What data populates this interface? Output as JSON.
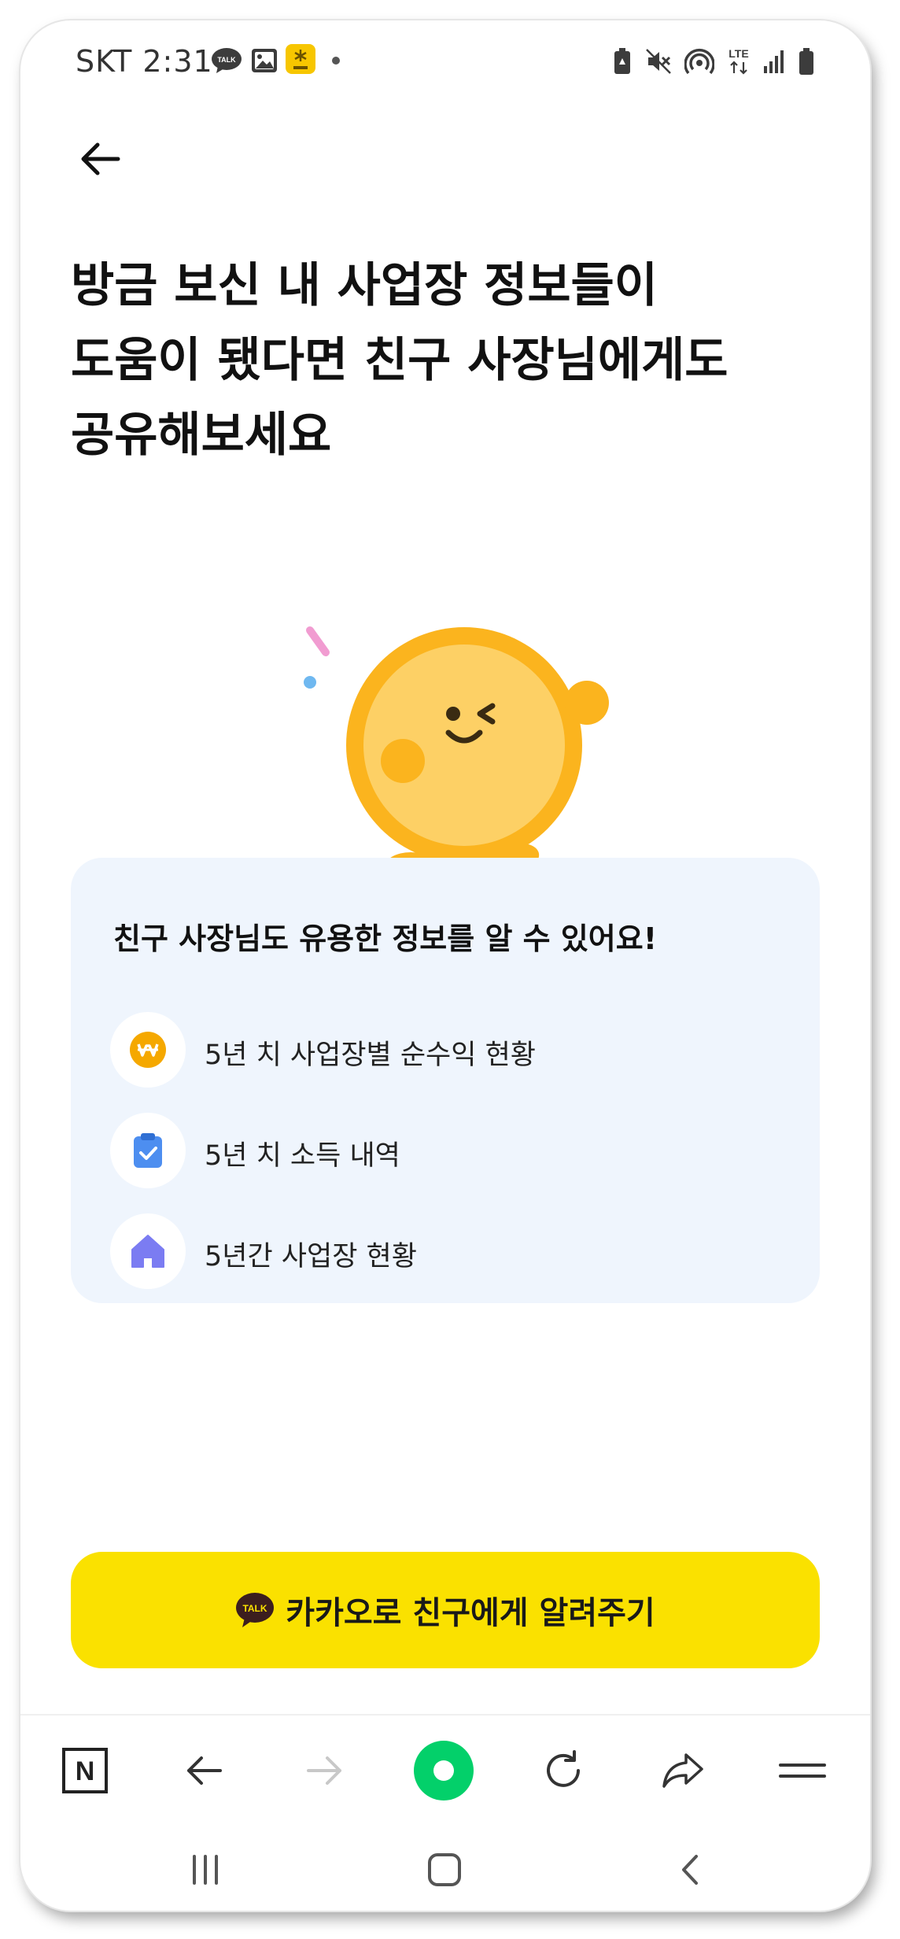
{
  "status_bar": {
    "carrier_time": "SKT 2:31",
    "talk_icon": "kakaotalk-notification-icon",
    "talk_badge": "TALK",
    "gallery_icon": "gallery-icon",
    "kb_icon": "kb-app-icon",
    "network_label": "LTE",
    "icons": [
      "battery-saver-icon",
      "mute-icon",
      "hotspot-icon",
      "lte-icon",
      "signal-icon",
      "battery-icon"
    ]
  },
  "header": {
    "back_icon": "arrow-left-icon",
    "title_lines": [
      "방금 보신 내 사업장 정보들이",
      "도움이 됐다면 친구 사장님에게도",
      "공유해보세요"
    ]
  },
  "mascot": {
    "icon": "winking-coin-mascot"
  },
  "info_card": {
    "title": "친구 사장님도 유용한 정보를 알 수 있어요!",
    "items": [
      {
        "icon": "won-coin-icon",
        "label": "5년 치 사업장별 순수익 현황"
      },
      {
        "icon": "clipboard-check-icon",
        "label": "5년 치 소득 내역"
      },
      {
        "icon": "house-icon",
        "label": "5년간 사업장 현황"
      }
    ]
  },
  "share_button": {
    "icon": "kakaotalk-icon",
    "icon_text": "TALK",
    "label": "카카오로 친구에게 알려주기"
  },
  "browser_bar": {
    "items": [
      "naver-n-icon",
      "back-arrow-icon",
      "forward-arrow-icon",
      "green-dot-icon",
      "refresh-icon",
      "share-arrow-icon",
      "menu-icon"
    ],
    "naver_letter": "N"
  },
  "system_nav": {
    "items": [
      "recent-apps-icon",
      "home-icon",
      "back-chevron-icon"
    ]
  },
  "colors": {
    "kakao_yellow": "#fae100",
    "card_bg": "#eff5fd",
    "coin_orange": "#f5a800",
    "clipboard_blue": "#4d8ef0",
    "house_purple": "#7b7cf2",
    "naver_green": "#03c75a"
  }
}
